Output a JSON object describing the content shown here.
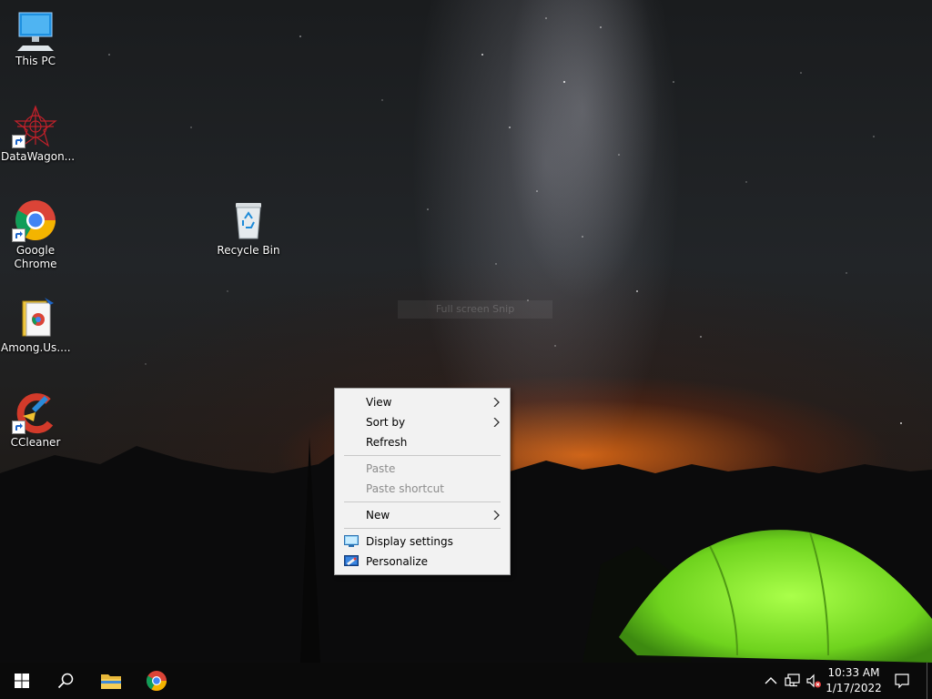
{
  "desktop": {
    "icons": [
      {
        "label": "This PC"
      },
      {
        "label": "DataWagon..."
      },
      {
        "label": "Google Chrome"
      },
      {
        "label": "Among.Us...."
      },
      {
        "label": "CCleaner"
      },
      {
        "label": "Recycle Bin"
      }
    ],
    "ghost_tooltip": "Full screen Snip"
  },
  "context_menu": {
    "items": [
      {
        "label": "View",
        "submenu": true,
        "enabled": true
      },
      {
        "label": "Sort by",
        "submenu": true,
        "enabled": true
      },
      {
        "label": "Refresh",
        "submenu": false,
        "enabled": true
      },
      {
        "label": "Paste",
        "submenu": false,
        "enabled": false
      },
      {
        "label": "Paste shortcut",
        "submenu": false,
        "enabled": false
      },
      {
        "label": "New",
        "submenu": true,
        "enabled": true
      },
      {
        "label": "Display settings",
        "icon": "display-icon",
        "enabled": true
      },
      {
        "label": "Personalize",
        "icon": "personalize-icon",
        "enabled": true
      }
    ]
  },
  "taskbar": {
    "clock": {
      "time": "10:33 AM",
      "date": "1/17/2022"
    },
    "pinned": [
      "start-icon",
      "search-icon",
      "file-explorer-icon",
      "chrome-icon"
    ],
    "tray": [
      "chevron-up-icon",
      "network-icon",
      "volume-muted-icon",
      "notification-icon"
    ]
  },
  "colors": {
    "taskbar": "#0a0a0a",
    "menu_bg": "#f2f2f2",
    "menu_disabled": "#8d8d8d",
    "windows_blue": "#00a4ef"
  }
}
